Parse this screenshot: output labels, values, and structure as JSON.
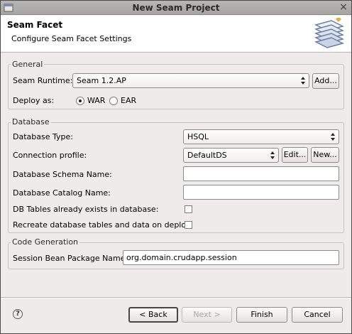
{
  "window": {
    "title": "New Seam Project",
    "close_glyph": "×"
  },
  "banner": {
    "title": "Seam Facet",
    "subtitle": "Configure Seam Facet Settings",
    "image_icon": "seam-wizard-icon"
  },
  "general": {
    "legend": "General",
    "runtime_label": "Seam Runtime:",
    "runtime_value": "Seam 1.2.AP",
    "add_button": "Add...",
    "deploy_label": "Deploy as:",
    "deploy_options": [
      {
        "label": "WAR",
        "checked": true
      },
      {
        "label": "EAR",
        "checked": false
      }
    ]
  },
  "database": {
    "legend": "Database",
    "type_label": "Database Type:",
    "type_value": "HSQL",
    "profile_label": "Connection profile:",
    "profile_value": "DefaultDS",
    "edit_button": "Edit...",
    "new_button": "New...",
    "schema_label": "Database Schema Name:",
    "schema_value": "",
    "catalog_label": "Database Catalog Name:",
    "catalog_value": "",
    "tables_exist_label": "DB Tables already exists in database:",
    "tables_exist_checked": false,
    "recreate_label": "Recreate database tables and data on deploy:",
    "recreate_checked": false
  },
  "codegen": {
    "legend": "Code Generation",
    "package_label": "Session Bean Package Name:",
    "package_value": "org.domain.crudapp.session"
  },
  "footer": {
    "help_glyph": "?",
    "back_button": "< Back",
    "next_button": "Next >",
    "finish_button": "Finish",
    "cancel_button": "Cancel"
  }
}
